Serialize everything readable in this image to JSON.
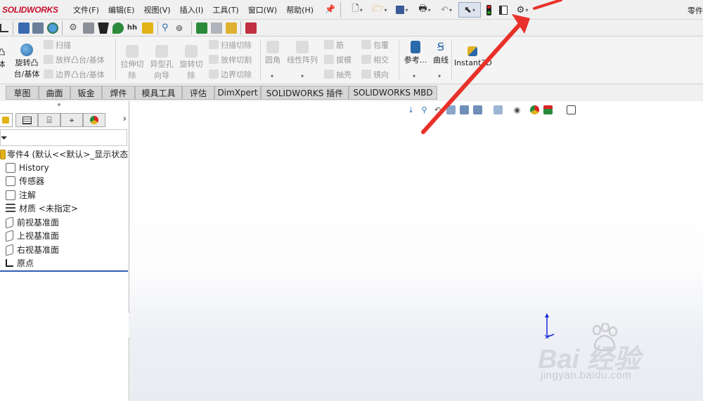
{
  "app": {
    "logo_text": "SOLIDWORKS",
    "title_right": "零件"
  },
  "menu": [
    {
      "label": "文件(F)"
    },
    {
      "label": "编辑(E)"
    },
    {
      "label": "视图(V)"
    },
    {
      "label": "插入(I)"
    },
    {
      "label": "工具(T)"
    },
    {
      "label": "窗口(W)"
    },
    {
      "label": "帮助(H)"
    }
  ],
  "quick_access_icons": [
    "new-document-icon",
    "open-icon",
    "save-icon",
    "print-icon",
    "undo-icon",
    "select-icon",
    "rebuild-icon",
    "file-properties-icon",
    "options-gear-icon"
  ],
  "ribbon": {
    "left_partial_label1": "凸",
    "left_partial_label2": "体",
    "revolve_boss": {
      "line1": "旋转凸",
      "line2": "台/基体"
    },
    "sweep": "扫描",
    "loft_boss": "放样凸台/基体",
    "boundary_boss": "边界凸台/基体",
    "extrude_cut": {
      "line1": "拉伸切",
      "line2": "除"
    },
    "hole_wizard": {
      "line1": "异型孔",
      "line2": "向导"
    },
    "revolve_cut": {
      "line1": "旋转切",
      "line2": "除"
    },
    "swept_cut": "扫描切除",
    "lofted_cut": "放样切割",
    "boundary_cut": "边界切除",
    "fillet": "圆角",
    "linear_pattern": "线性阵列",
    "rib": "筋",
    "draft": "拔模",
    "shell": "抽壳",
    "wrap": "包覆",
    "intersect": "相交",
    "mirror": "镜向",
    "reference": "参考...",
    "curves": "曲线",
    "instant3d": "Instant3D"
  },
  "command_tabs": [
    {
      "label": "草图"
    },
    {
      "label": "曲面"
    },
    {
      "label": "钣金"
    },
    {
      "label": "焊件"
    },
    {
      "label": "模具工具"
    },
    {
      "label": "评估"
    },
    {
      "label": "DimXpert"
    },
    {
      "label": "SOLIDWORKS 插件"
    },
    {
      "label": "SOLIDWORKS MBD"
    }
  ],
  "panel_tab_arrow": "›",
  "tree": {
    "root": "零件4 (默认<<默认>_显示状态",
    "items": [
      {
        "label": "History"
      },
      {
        "label": "传感器"
      },
      {
        "label": "注解"
      },
      {
        "label": "材质 <未指定>"
      },
      {
        "label": "前视基准面"
      },
      {
        "label": "上视基准面"
      },
      {
        "label": "右视基准面"
      },
      {
        "label": "原点"
      }
    ]
  },
  "watermark": {
    "main": "Bai  经验",
    "sub": "jingyan.baidu.com"
  },
  "colors": {
    "logo_red": "#c8102e",
    "annotation_red": "#e8312a",
    "tree_selection_blue": "#2f5fb0"
  }
}
